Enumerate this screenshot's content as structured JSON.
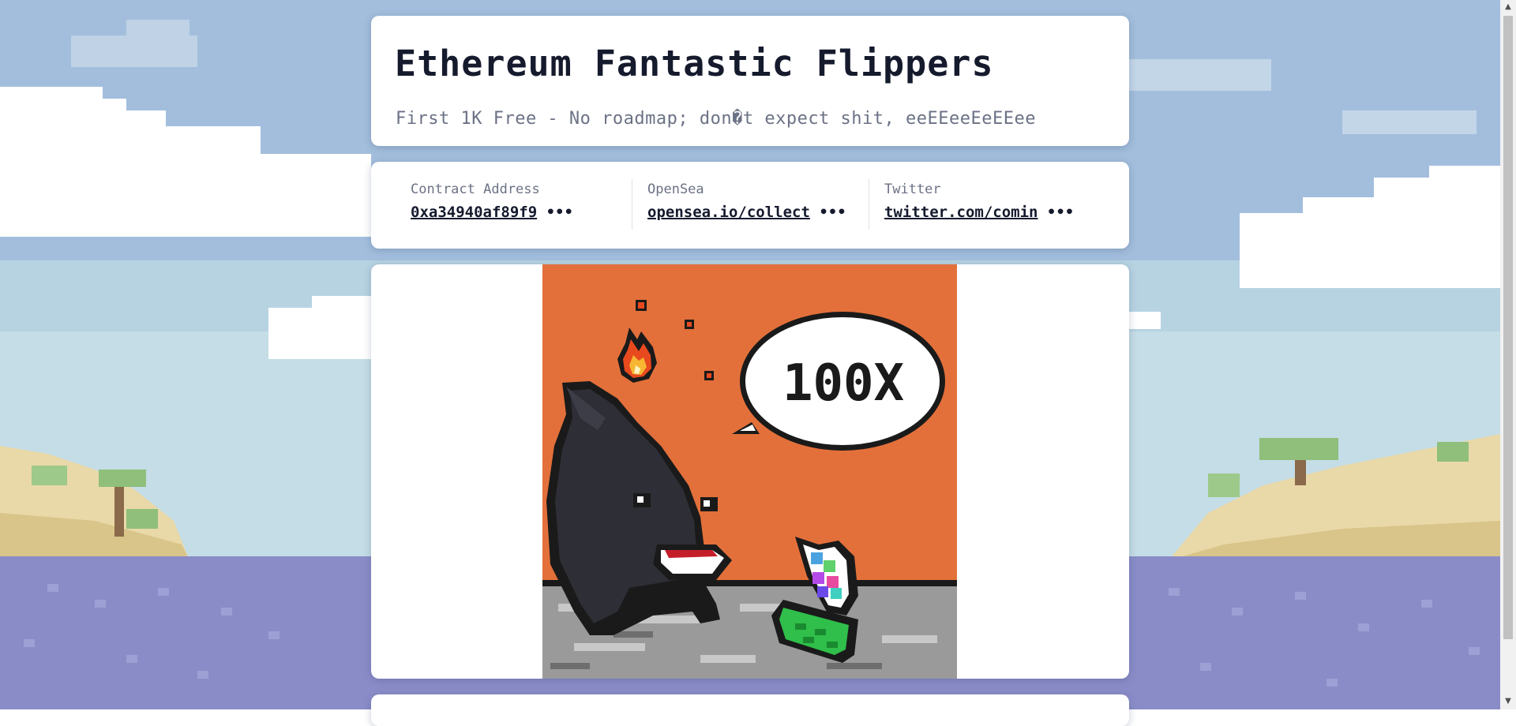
{
  "page": {
    "title": "Ethereum Fantastic Flippers",
    "subtitle": "First 1K Free - No roadmap; don�t expect shit, eeEEeeEeEEee"
  },
  "links": [
    {
      "label": "Contract Address",
      "value": "0xa34940af89f9",
      "ellipsis": "•••"
    },
    {
      "label": "OpenSea",
      "value": "opensea.io/collect",
      "ellipsis": "•••"
    },
    {
      "label": "Twitter",
      "value": "twitter.com/comin",
      "ellipsis": "•••"
    }
  ],
  "artwork": {
    "speech_text": "100X",
    "background_color": "#e3703a"
  },
  "colors": {
    "sky": "#a3bedd",
    "sea": "#8a8cc8",
    "sand": "#e9d9a8",
    "card": "#ffffff",
    "text_dark": "#151a2d",
    "text_muted": "#6b7285"
  },
  "scrollbar": {
    "up_icon": "▲",
    "down_icon": "▼"
  }
}
